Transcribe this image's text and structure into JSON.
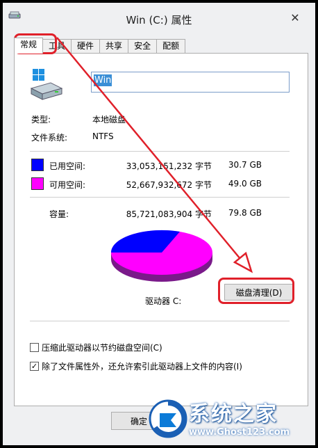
{
  "window": {
    "title": "Win (C:) 属性",
    "close_glyph": "✕"
  },
  "tabs": [
    {
      "label": "常规",
      "active": true
    },
    {
      "label": "工具",
      "active": false
    },
    {
      "label": "硬件",
      "active": false
    },
    {
      "label": "共享",
      "active": false
    },
    {
      "label": "安全",
      "active": false
    },
    {
      "label": "配额",
      "active": false
    }
  ],
  "general": {
    "drive_name_value": "Win",
    "type_label": "类型:",
    "type_value": "本地磁盘",
    "fs_label": "文件系统:",
    "fs_value": "NTFS",
    "used": {
      "label": "已用空间:",
      "bytes": "33,053,151,232 字节",
      "size": "30.7 GB",
      "color": "#0000ff"
    },
    "free": {
      "label": "可用空间:",
      "bytes": "52,667,932,672 字节",
      "size": "49.0 GB",
      "color": "#ff00ff"
    },
    "capacity": {
      "label": "容量:",
      "bytes": "85,721,083,904 字节",
      "size": "79.8 GB"
    },
    "drive_label": "驱动器 C:",
    "cleanup_button": "磁盘清理(D)",
    "compress_checkbox": {
      "label": "压缩此驱动器以节约磁盘空间(C)",
      "checked": false
    },
    "index_checkbox": {
      "label": "除了文件属性外，还允许索引此驱动器上文件的内容(I)",
      "checked": true
    },
    "ok_button": "确定"
  },
  "annotation": {
    "color": "#e0202a"
  },
  "watermark": {
    "title": "系统之家",
    "url": "www.Ghost123.com"
  }
}
